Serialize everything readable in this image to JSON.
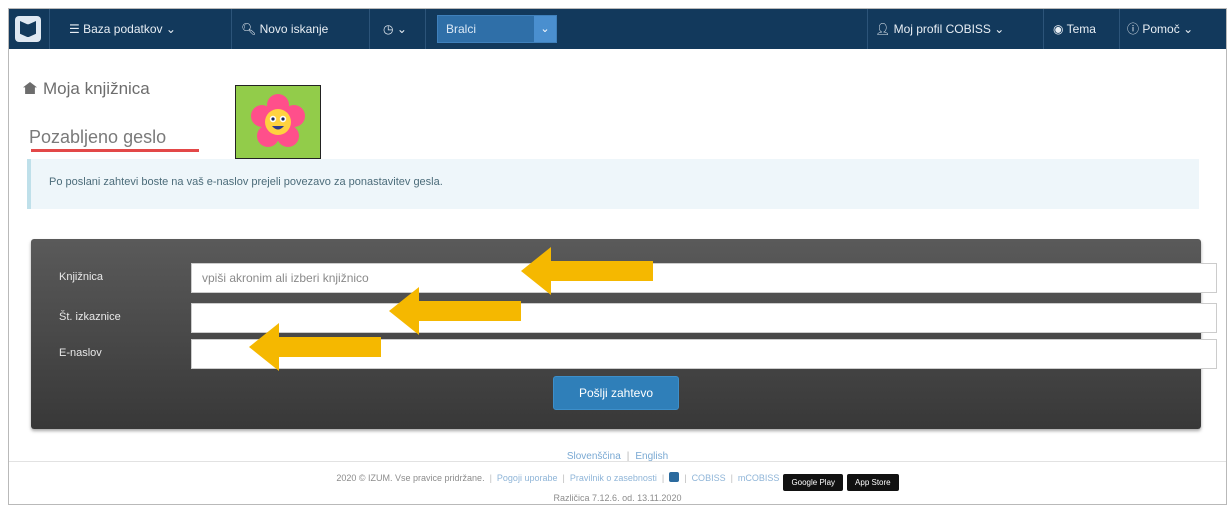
{
  "navbar": {
    "database_label": "Baza podatkov",
    "new_search_label": "Novo iskanje",
    "search_scope": "Bralci",
    "profile_label": "Moj profil COBISS",
    "theme_label": "Tema",
    "help_label": "Pomoč"
  },
  "breadcrumb": "Moja knjižnica",
  "page_title": "Pozabljeno geslo",
  "info_message": "Po poslani zahtevi boste na vaš e-naslov prejeli povezavo za ponastavitev gesla.",
  "form": {
    "library_label": "Knjižnica",
    "library_placeholder": "vpiši akronim ali izberi knjižnico",
    "card_label": "Št. izkaznice",
    "email_label": "E-naslov",
    "submit_label": "Pošlji zahtevo"
  },
  "footer": {
    "lang_sl": "Slovenščina",
    "lang_en": "English",
    "copyright": "2020 © IZUM. Vse pravice pridržane.",
    "terms": "Pogoji uporabe",
    "privacy": "Pravilnik o zasebnosti",
    "cobiss": "COBISS",
    "mcobiss": "mCOBISS",
    "google_play": "Google Play",
    "app_store": "App Store",
    "version": "Različica 7.12.6. od. 13.11.2020"
  },
  "colors": {
    "navbar": "#12395c",
    "accent_underline": "#e34848",
    "arrow": "#f5b800",
    "panel": "#444444",
    "submit": "#2f7fb9"
  }
}
